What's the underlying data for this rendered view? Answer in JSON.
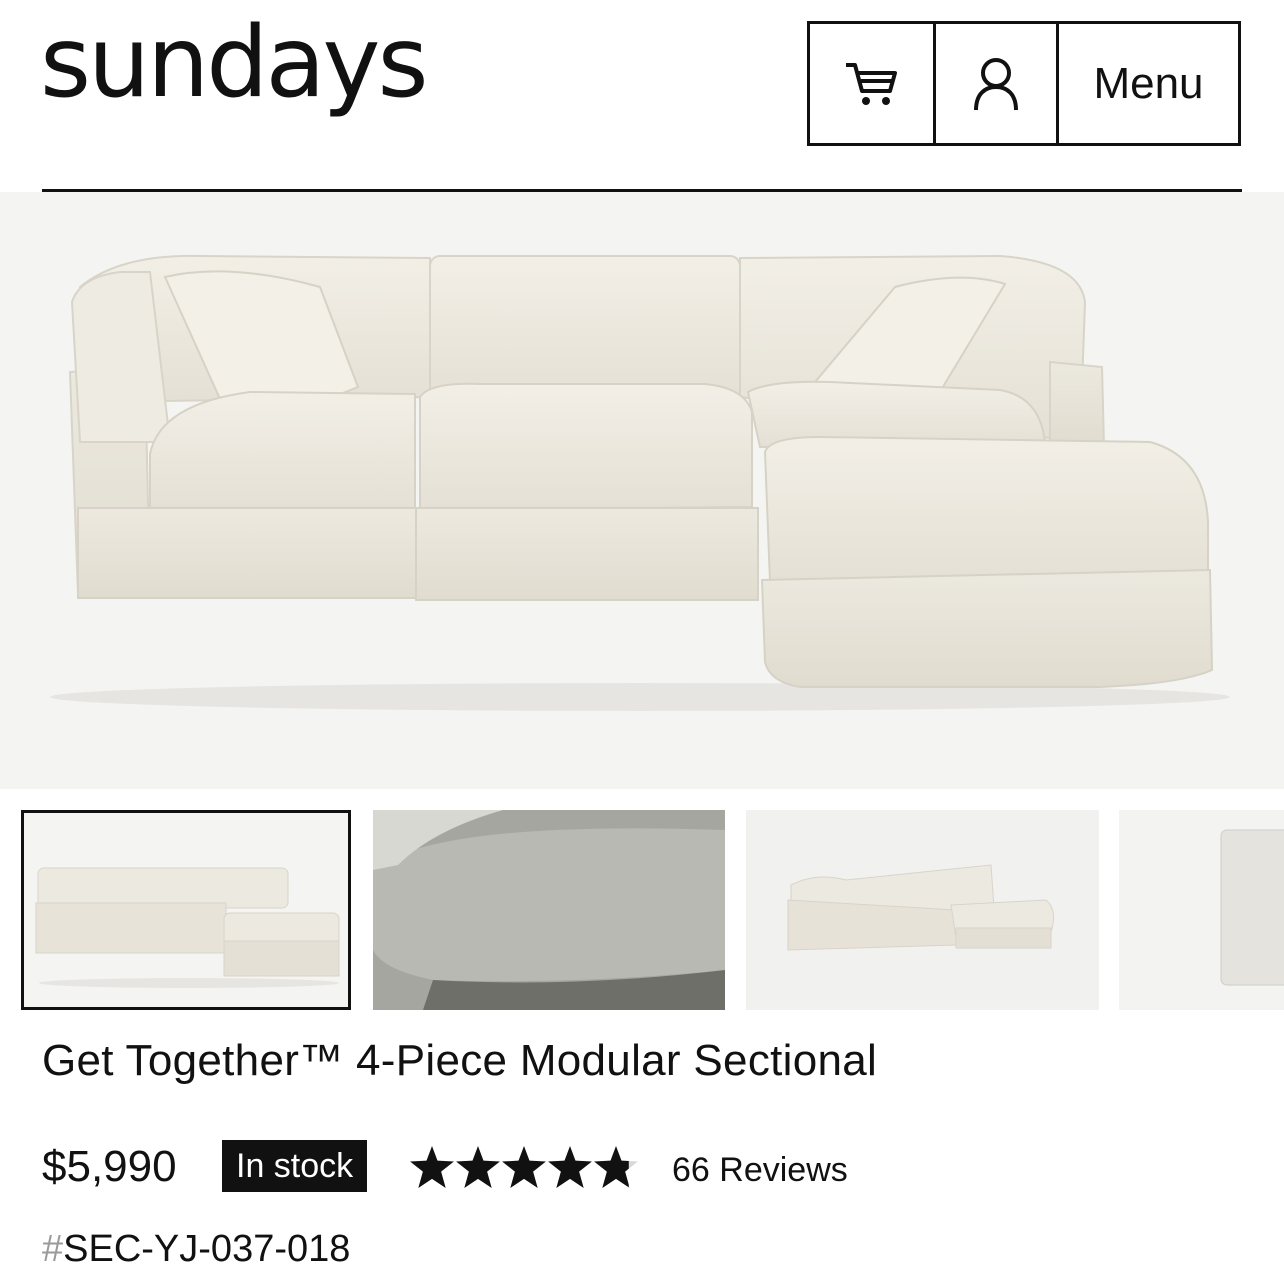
{
  "header": {
    "logo": "sundays",
    "menu_label": "Menu",
    "cart_icon": "shopping-cart-icon",
    "account_icon": "user-icon"
  },
  "gallery": {
    "main_image": "4-piece-modular-sectional-cream",
    "thumbnails": [
      {
        "name": "sectional-front-view",
        "selected": true
      },
      {
        "name": "fabric-closeup",
        "selected": false
      },
      {
        "name": "sectional-angle-view",
        "selected": false
      },
      {
        "name": "fabric-swatch",
        "selected": false
      }
    ]
  },
  "product": {
    "title": "Get Together™ 4-Piece Modular Sectional",
    "price": "$5,990",
    "stock_badge": "In stock",
    "rating": 4.8,
    "reviews": "66 Reviews",
    "sku_hash": "#",
    "sku": "SEC-YJ-037-018"
  },
  "colors": {
    "fabric": "#efece3",
    "background": "#f4f4f2",
    "ink": "#111111"
  }
}
